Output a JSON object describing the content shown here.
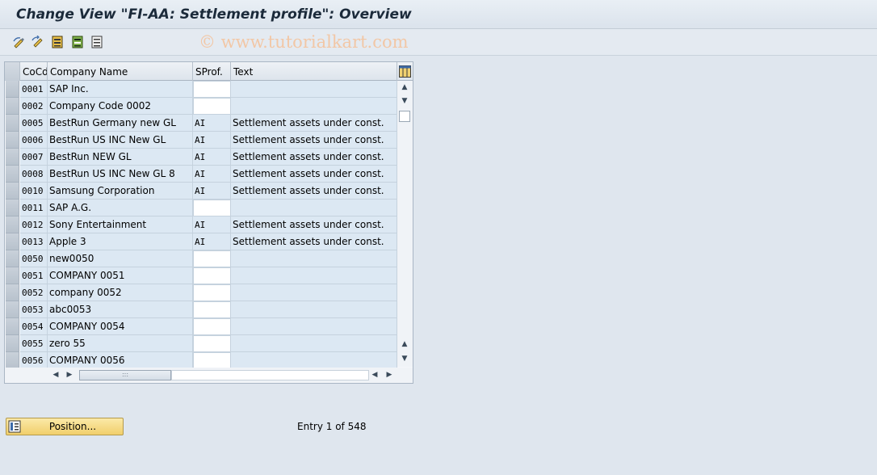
{
  "window": {
    "title": "Change View \"FI-AA: Settlement profile\": Overview"
  },
  "watermark": "© www.tutorialkart.com",
  "toolbar": {
    "icons": [
      "display-change-icon",
      "other-view-icon",
      "select-all-icon",
      "select-block-icon",
      "deselect-all-icon"
    ]
  },
  "table": {
    "columns": [
      "CoCd",
      "Company Name",
      "SProf.",
      "Text"
    ],
    "rows": [
      {
        "cocd": "0001",
        "name": "SAP Inc.",
        "sprof": "",
        "text": ""
      },
      {
        "cocd": "0002",
        "name": "Company Code 0002",
        "sprof": "",
        "text": ""
      },
      {
        "cocd": "0005",
        "name": "BestRun Germany new GL",
        "sprof": "AI",
        "text": "Settlement assets under const."
      },
      {
        "cocd": "0006",
        "name": "BestRun US INC New GL",
        "sprof": "AI",
        "text": "Settlement assets under const."
      },
      {
        "cocd": "0007",
        "name": "BestRun NEW GL",
        "sprof": "AI",
        "text": "Settlement assets under const."
      },
      {
        "cocd": "0008",
        "name": "BestRun US INC New GL 8",
        "sprof": "AI",
        "text": "Settlement assets under const."
      },
      {
        "cocd": "0010",
        "name": "Samsung Corporation",
        "sprof": "AI",
        "text": "Settlement assets under const."
      },
      {
        "cocd": "0011",
        "name": "SAP A.G.",
        "sprof": "",
        "text": ""
      },
      {
        "cocd": "0012",
        "name": "Sony Entertainment",
        "sprof": "AI",
        "text": "Settlement assets under const."
      },
      {
        "cocd": "0013",
        "name": "Apple 3",
        "sprof": "AI",
        "text": "Settlement assets under const."
      },
      {
        "cocd": "0050",
        "name": "new0050",
        "sprof": "",
        "text": ""
      },
      {
        "cocd": "0051",
        "name": "COMPANY 0051",
        "sprof": "",
        "text": ""
      },
      {
        "cocd": "0052",
        "name": "company 0052",
        "sprof": "",
        "text": ""
      },
      {
        "cocd": "0053",
        "name": "abc0053",
        "sprof": "",
        "text": ""
      },
      {
        "cocd": "0054",
        "name": "COMPANY 0054",
        "sprof": "",
        "text": ""
      },
      {
        "cocd": "0055",
        "name": "zero 55",
        "sprof": "",
        "text": ""
      },
      {
        "cocd": "0056",
        "name": "COMPANY 0056",
        "sprof": "",
        "text": ""
      }
    ]
  },
  "footer": {
    "position_label": "Position...",
    "entry_text": "Entry 1 of 548"
  },
  "colors": {
    "cell_bg": "#dce8f3",
    "input_bg": "#ffffff",
    "button_bg": "#f1cf6b"
  }
}
